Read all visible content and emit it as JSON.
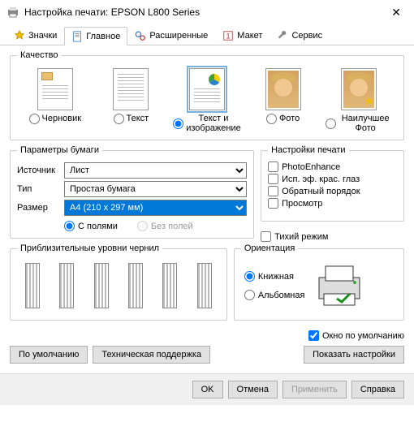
{
  "window": {
    "title": "Настройка печати: EPSON L800 Series"
  },
  "tabs": {
    "icons": "Значки",
    "main": "Главное",
    "advanced": "Расширенные",
    "layout": "Макет",
    "service": "Сервис"
  },
  "quality": {
    "legend": "Качество",
    "draft": "Черновик",
    "text": "Текст",
    "text_image": "Текст и изображение",
    "photo": "Фото",
    "best_photo": "Наилучшее Фото"
  },
  "paper": {
    "legend": "Параметры бумаги",
    "source_label": "Источник",
    "source_value": "Лист",
    "type_label": "Тип",
    "type_value": "Простая бумага",
    "size_label": "Размер",
    "size_value": "A4 (210 x 297 мм)",
    "with_margins": "С полями",
    "no_margins": "Без полей"
  },
  "print_settings": {
    "legend": "Настройки печати",
    "photoenhance": "PhotoEnhance",
    "redeye": "Исп. эф. крас. глаз",
    "reverse": "Обратный порядок",
    "preview": "Просмотр",
    "quiet": "Тихий режим"
  },
  "ink": {
    "legend": "Приблизительные уровни чернил"
  },
  "orientation": {
    "legend": "Ориентация",
    "portrait": "Книжная",
    "landscape": "Альбомная"
  },
  "default_window": "Окно по умолчанию",
  "buttons": {
    "defaults": "По умолчанию",
    "support": "Техническая поддержка",
    "show_settings": "Показать настройки",
    "ok": "OK",
    "cancel": "Отмена",
    "apply": "Применить",
    "help": "Справка"
  }
}
